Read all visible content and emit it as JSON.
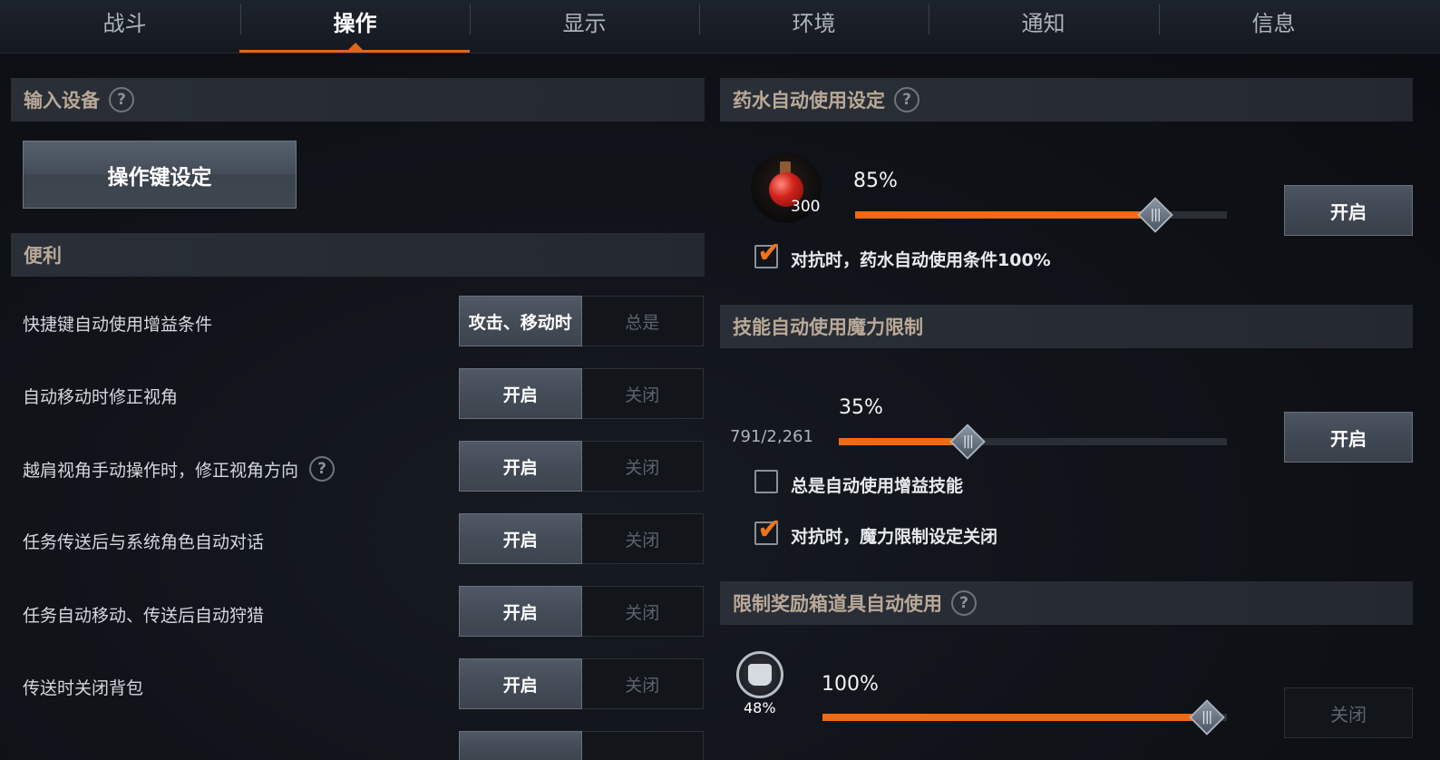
{
  "tabs": [
    {
      "label": "战斗"
    },
    {
      "label": "操作"
    },
    {
      "label": "显示"
    },
    {
      "label": "环境"
    },
    {
      "label": "通知"
    },
    {
      "label": "信息"
    }
  ],
  "active_tab": "操作",
  "accent_color": "#f06a12",
  "left": {
    "input_section": {
      "title": "输入设备",
      "button": "操作键设定"
    },
    "convenience_section": {
      "title": "便利"
    },
    "rows": [
      {
        "label": "快捷键自动使用增益条件",
        "on": "攻击、移动时",
        "off": "总是"
      },
      {
        "label": "自动移动时修正视角",
        "on": "开启",
        "off": "关闭"
      },
      {
        "label": "越肩视角手动操作时，修正视角方向",
        "on": "开启",
        "off": "关闭"
      },
      {
        "label": "任务传送后与系统角色自动对话",
        "on": "开启",
        "off": "关闭"
      },
      {
        "label": "任务自动移动、传送后自动狩猎",
        "on": "开启",
        "off": "关闭"
      },
      {
        "label": "传送时关闭背包",
        "on": "开启",
        "off": "关闭"
      }
    ]
  },
  "right": {
    "potion": {
      "title": "药水自动使用设定",
      "count": "300",
      "percent_label": "85%",
      "percent": 85,
      "button": "开启",
      "check_label": "对抗时，药水自动使用条件100%",
      "checked": true
    },
    "skill": {
      "title": "技能自动使用魔力限制",
      "mp": "791/2,261",
      "percent_label": "35%",
      "percent": 35,
      "button": "开启",
      "check1_label": "总是自动使用增益技能",
      "check1": false,
      "check2_label": "对抗时，魔力限制设定关闭",
      "check2": true
    },
    "chest": {
      "title": "限制奖励箱道具自动使用",
      "icon_pct": "48%",
      "percent_label": "100%",
      "percent": 100,
      "button": "关闭"
    }
  }
}
